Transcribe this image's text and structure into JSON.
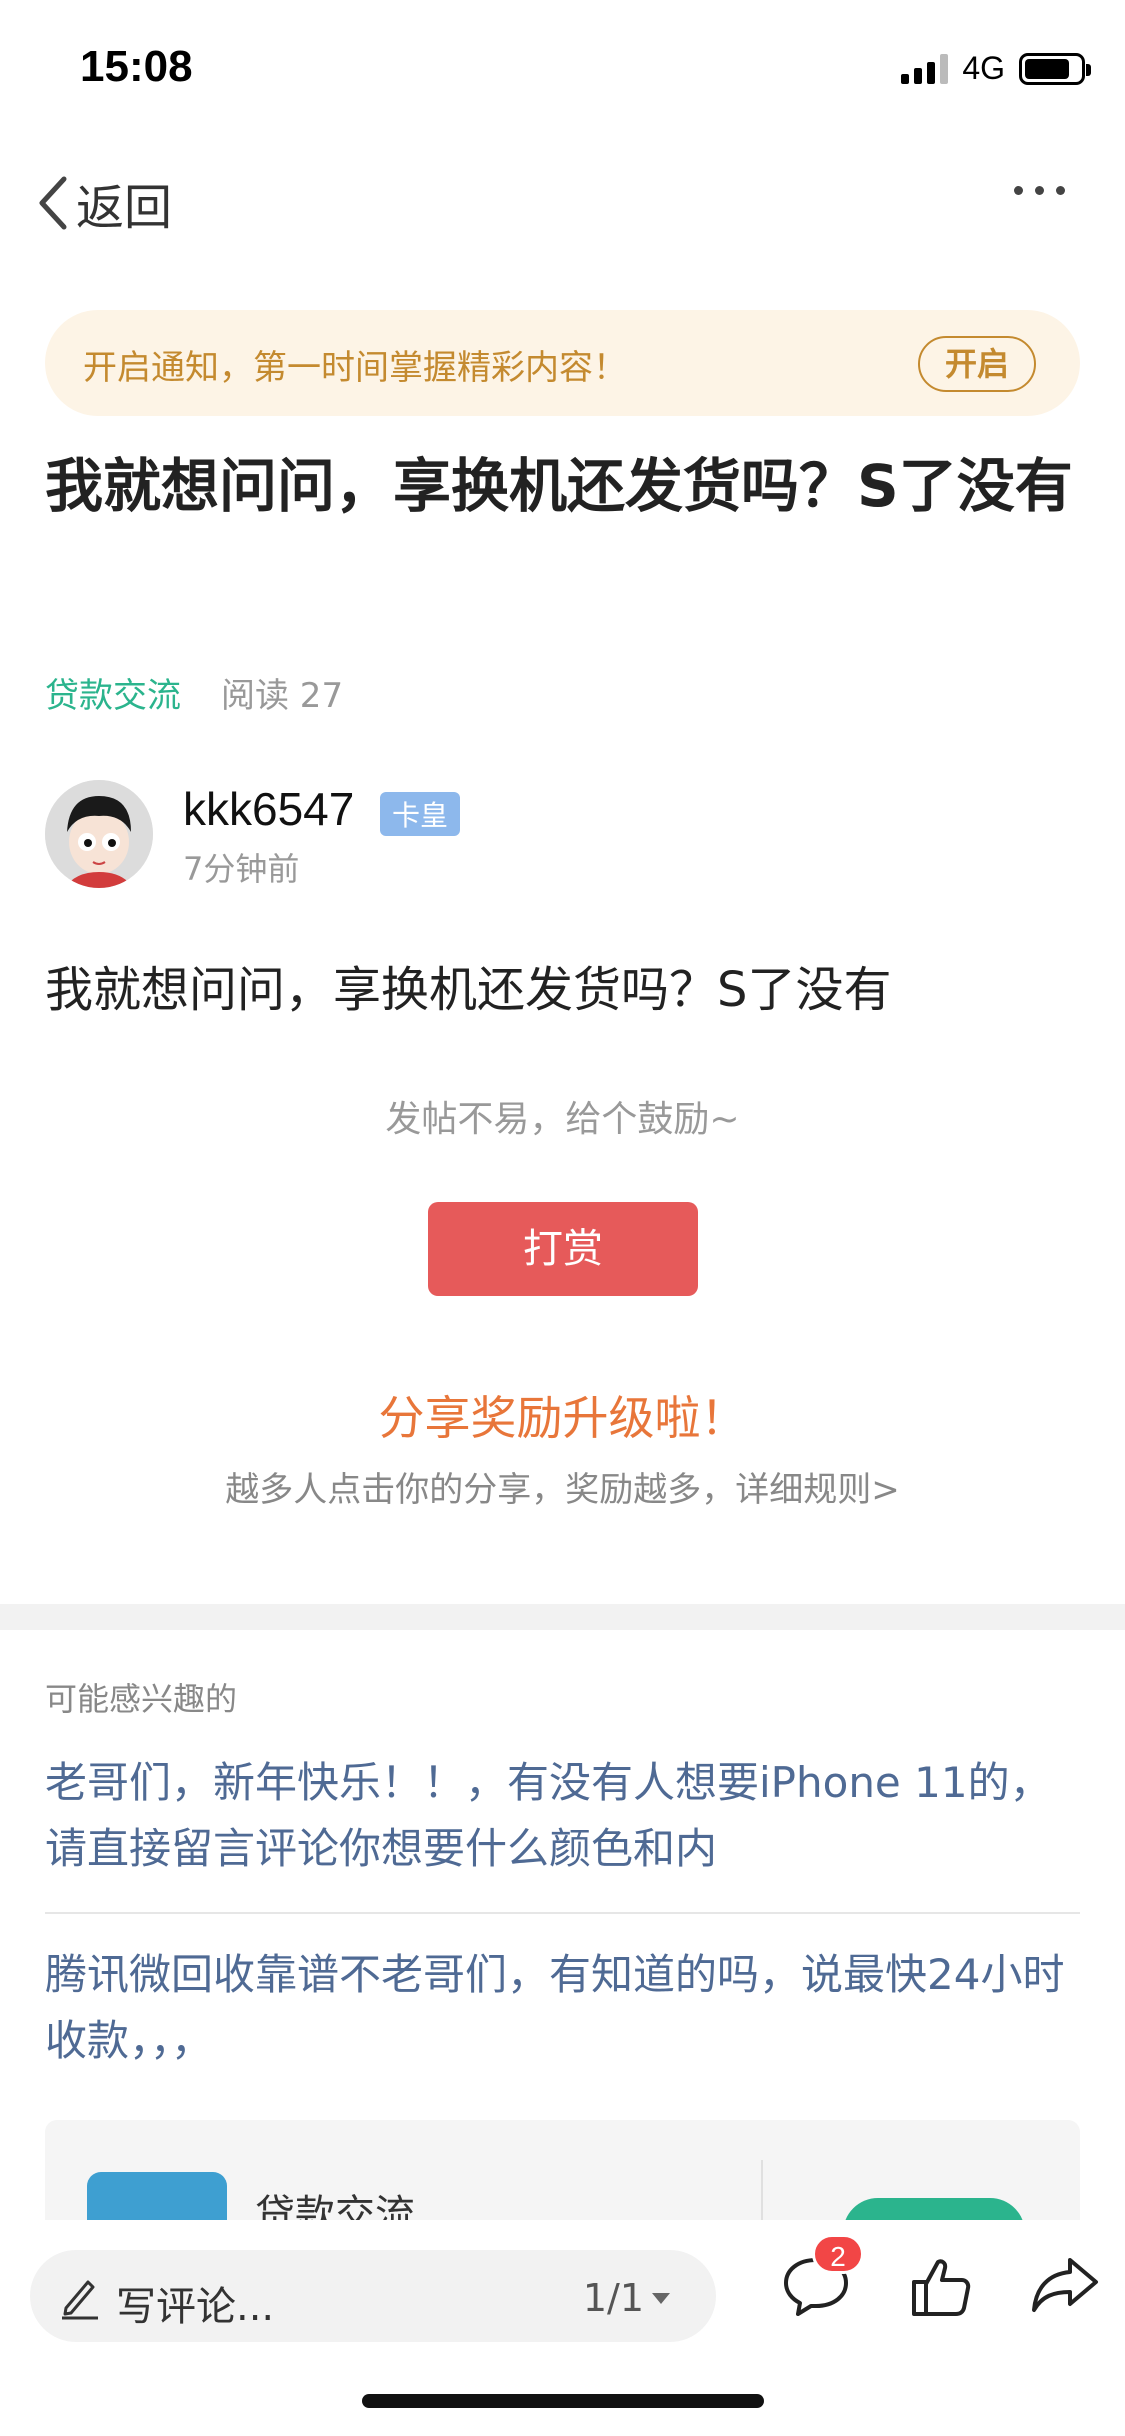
{
  "status_bar": {
    "time": "15:08",
    "network": "4G"
  },
  "nav": {
    "back_label": "返回",
    "more_icon": "more-dots-icon"
  },
  "notification": {
    "text": "开启通知，第一时间掌握精彩内容！",
    "button": "开启"
  },
  "post": {
    "title": "我就想问问，享换机还发货吗？S了没有",
    "forum": "贷款交流",
    "reads": "阅读 27",
    "author": {
      "name": "kkk6547",
      "badge": "卡皇",
      "time": "7分钟前"
    },
    "content": "我就想问问，享换机还发货吗？S了没有"
  },
  "reward": {
    "prompt": "发帖不易，给个鼓励~",
    "button": "打赏"
  },
  "share": {
    "title": "分享奖励升级啦！",
    "subtitle": "越多人点击你的分享，奖励越多，详细规则>"
  },
  "related": {
    "heading": "可能感兴趣的",
    "items": [
      "老哥们，新年快乐！！，有没有人想要iPhone 11的，请直接留言评论你想要什么颜色和内",
      "腾讯微回收靠谱不老哥们，有知道的吗，说最快24小时收款，，，"
    ]
  },
  "forum_card": {
    "name": "贷款交流"
  },
  "bottom_bar": {
    "comment_placeholder": "写评论...",
    "page_indicator": "1/1",
    "comment_count": "2"
  },
  "colors": {
    "accent_green": "#2bb48d",
    "reward_red": "#e65a5a",
    "share_orange": "#e8763a",
    "notify_gold": "#c48a2f",
    "link_blue": "#4f6a94"
  }
}
